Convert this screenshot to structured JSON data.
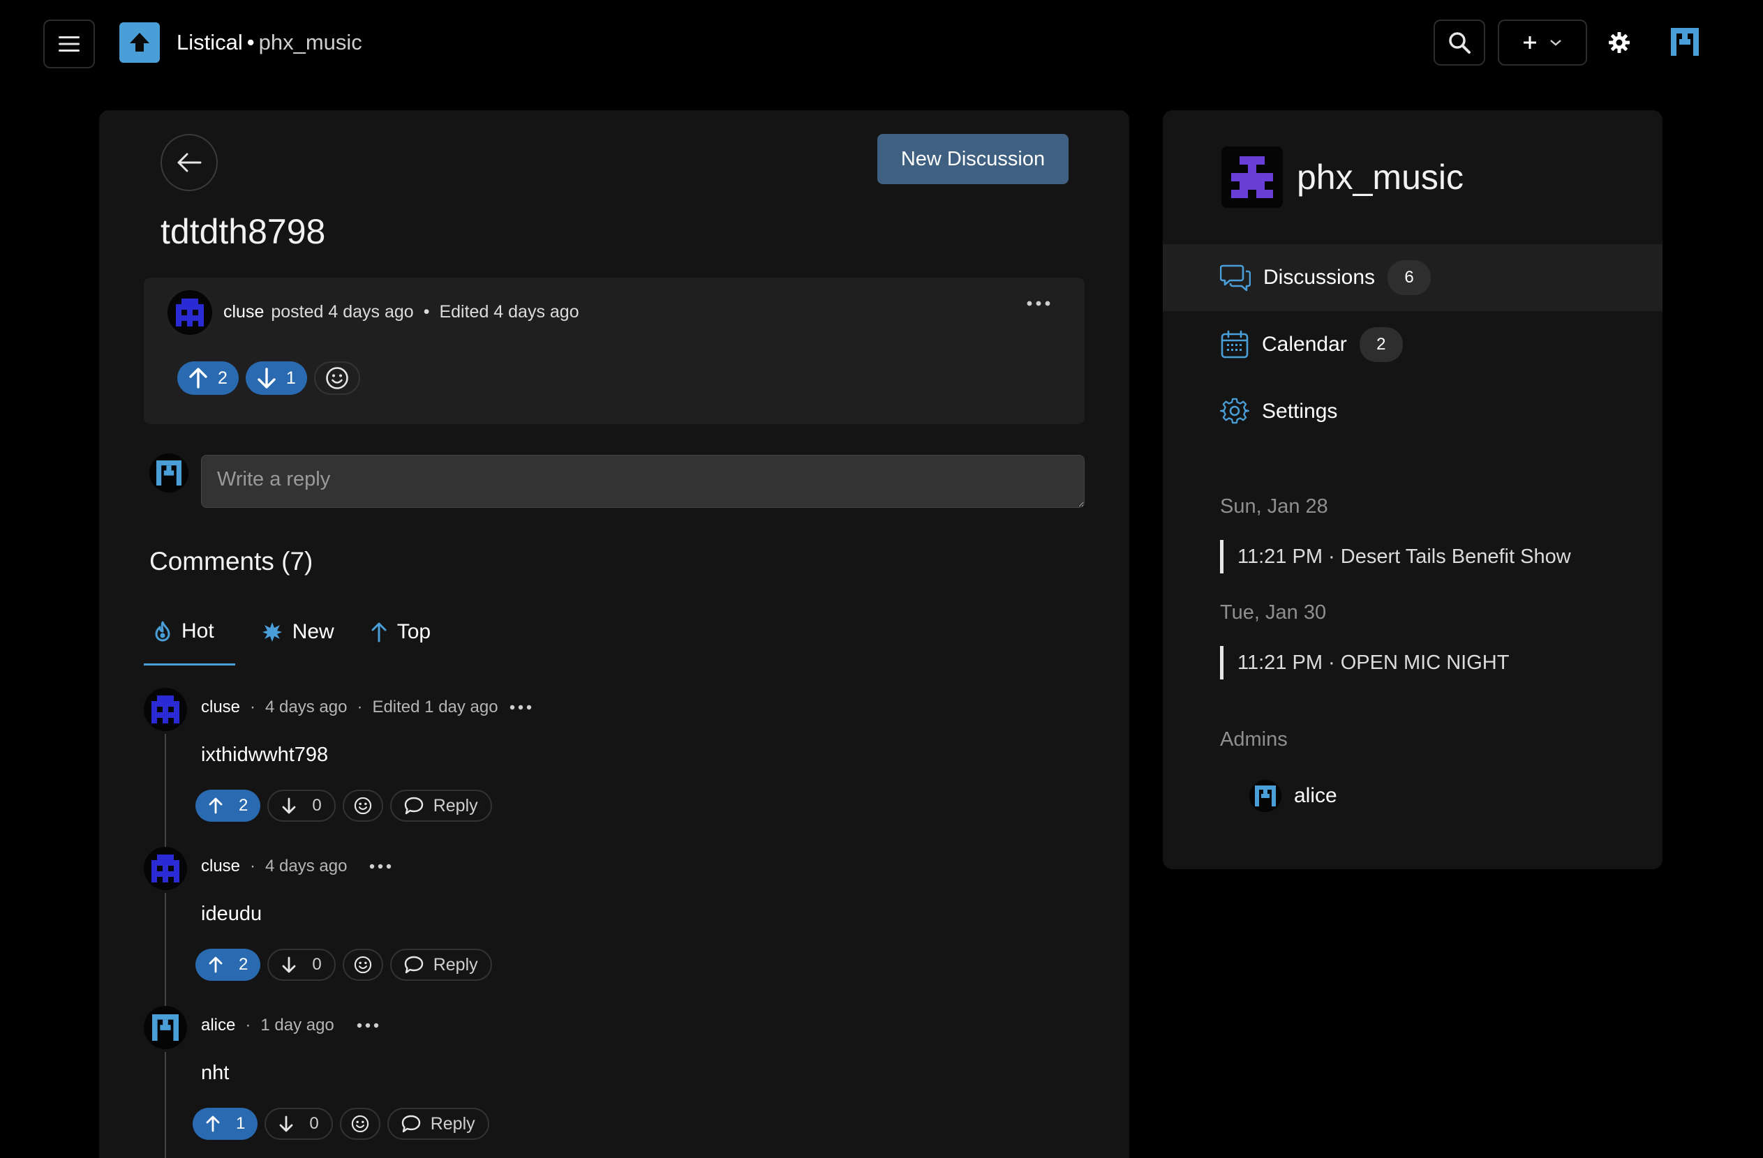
{
  "header": {
    "app_name": "Listical",
    "separator": "•",
    "community": "phx_music"
  },
  "discussion": {
    "back_label": "Back",
    "new_discussion_label": "New Discussion",
    "title": "tdtdth8798",
    "post": {
      "author": "cluse",
      "posted": "posted 4 days ago",
      "dot": "•",
      "edited": "Edited 4 days ago",
      "upvotes": "2",
      "downvotes": "1"
    },
    "reply_placeholder": "Write a reply"
  },
  "comments": {
    "heading": "Comments (7)",
    "tabs": [
      {
        "label": "Hot",
        "icon": "flame-icon"
      },
      {
        "label": "New",
        "icon": "sparkle-icon"
      },
      {
        "label": "Top",
        "icon": "arrow-up-icon"
      }
    ],
    "reply_label": "Reply",
    "dot": "·",
    "items": [
      {
        "author": "cluse",
        "time": "4 days ago",
        "edited": "Edited 1 day ago",
        "body": "ixthidwwht798",
        "upvotes": "2",
        "downvotes": "0"
      },
      {
        "author": "cluse",
        "time": "4 days ago",
        "edited": "",
        "body": "ideudu",
        "upvotes": "2",
        "downvotes": "0"
      },
      {
        "author": "alice",
        "time": "1 day ago",
        "edited": "",
        "body": "nht",
        "upvotes": "1",
        "downvotes": "0"
      }
    ]
  },
  "sidebar": {
    "title": "phx_music",
    "nav": [
      {
        "label": "Discussions",
        "count": "6",
        "icon": "chat-bubbles-icon"
      },
      {
        "label": "Calendar",
        "count": "2",
        "icon": "calendar-icon"
      },
      {
        "label": "Settings",
        "count": "",
        "icon": "gear-icon"
      }
    ],
    "events": [
      {
        "day": "Sun, Jan 28",
        "item": "11:21 PM · Desert Tails Benefit Show"
      },
      {
        "day": "Tue, Jan 30",
        "item": "11:21 PM · OPEN MIC NIGHT"
      }
    ],
    "admins_label": "Admins",
    "admins": [
      "alice"
    ]
  },
  "colors": {
    "accent": "#4a9fd8",
    "vote_active": "#2a6ab0",
    "button": "#3f6080",
    "panel": "#141414",
    "avatar_blue": "#2b2bd6",
    "avatar_purple": "#6a3fd8"
  }
}
